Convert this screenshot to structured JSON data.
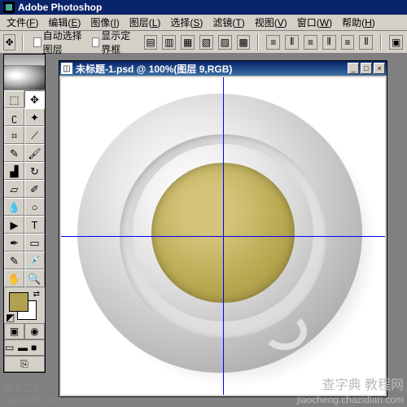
{
  "app": {
    "title": "Adobe Photoshop"
  },
  "menu": {
    "items": [
      {
        "label": "文件",
        "key": "F"
      },
      {
        "label": "编辑",
        "key": "E"
      },
      {
        "label": "图像",
        "key": "I"
      },
      {
        "label": "图层",
        "key": "L"
      },
      {
        "label": "选择",
        "key": "S"
      },
      {
        "label": "滤镜",
        "key": "T"
      },
      {
        "label": "视图",
        "key": "V"
      },
      {
        "label": "窗口",
        "key": "W"
      },
      {
        "label": "帮助",
        "key": "H"
      }
    ]
  },
  "options": {
    "auto_select_layer": "自动选择图层",
    "show_bounding_box": "显示定界框"
  },
  "document": {
    "title": "未标题-1.psd @ 100%(图层 9,RGB)"
  },
  "tools": {
    "rows": [
      [
        "marquee",
        "move"
      ],
      [
        "lasso",
        "wand"
      ],
      [
        "crop",
        "slice"
      ],
      [
        "airbrush",
        "brush"
      ],
      [
        "stamp",
        "history-brush"
      ],
      [
        "eraser",
        "pencil"
      ],
      [
        "blur",
        "dodge"
      ],
      [
        "path-select",
        "type"
      ],
      [
        "pen",
        "shape"
      ],
      [
        "notes",
        "eyedropper"
      ],
      [
        "hand",
        "zoom"
      ]
    ],
    "glyphs": {
      "marquee": "⬚",
      "move": "✥",
      "lasso": "ʗ",
      "wand": "✦",
      "crop": "⌗",
      "slice": "⟋",
      "airbrush": "✎",
      "brush": "🖌",
      "stamp": "▟",
      "history-brush": "↻",
      "eraser": "▱",
      "pencil": "✐",
      "blur": "💧",
      "dodge": "○",
      "path-select": "▶",
      "type": "T",
      "pen": "✒",
      "shape": "▭",
      "notes": "✎",
      "eyedropper": "💉",
      "hand": "✋",
      "zoom": "🔍"
    },
    "active": "move",
    "fg_color": "#b0a050",
    "bg_color": "#ffffff"
  },
  "watermarks": {
    "left_line1": "脚本之家",
    "left_line2": "www.jb51.net",
    "right_line1": "查字典 教程网",
    "right_line2": "jiaocheng.chazidian.com"
  }
}
